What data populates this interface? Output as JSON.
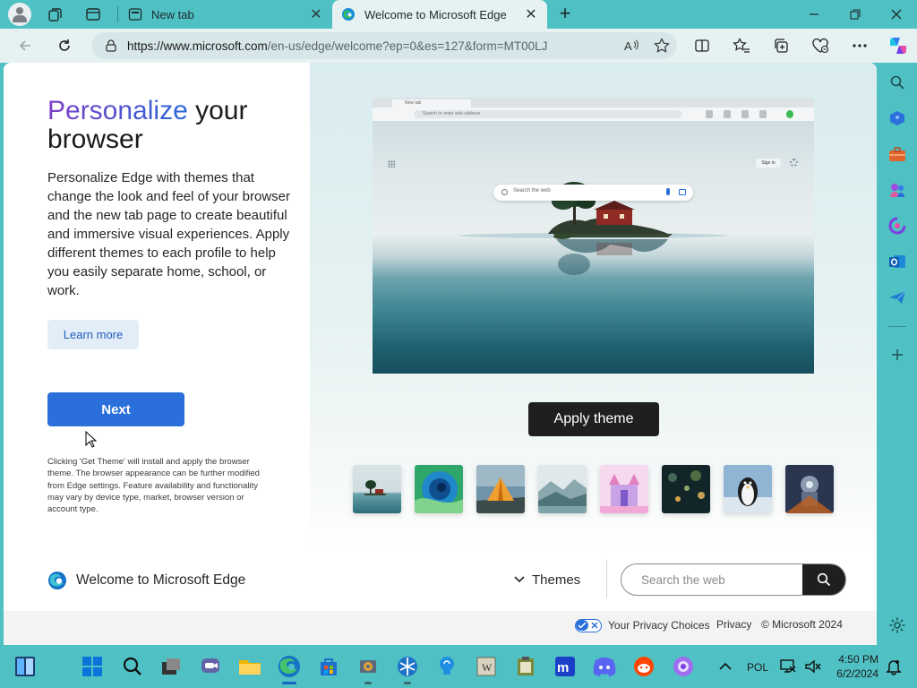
{
  "window": {
    "tabs": [
      {
        "title": "New tab"
      },
      {
        "title": "Welcome to Microsoft Edge"
      }
    ],
    "close_symbol": "✕"
  },
  "addressbar": {
    "url_host": "https://www.microsoft.com",
    "url_path": "/en-us/edge/welcome?ep=0&es=127&form=MT00LJ"
  },
  "left": {
    "headline_accent": "Personalize",
    "headline_rest": " your browser",
    "body": "Personalize Edge with themes that change the look and feel of your browser and the new tab page to create beautiful and immersive visual experiences. Apply different themes to each profile to help you easily separate home, school, or work.",
    "learn_more_label": "Learn more",
    "next_label": "Next",
    "disclaimer": "Clicking 'Get Theme' will install and apply the browser theme. The browser appearance can be further modified from Edge settings. Feature availability and functionality may vary by device type, market, browser version or account type."
  },
  "preview": {
    "tab_title": "New tab",
    "address_placeholder": "Search or enter web address",
    "search_placeholder": "Search the web",
    "signin": "Sign in"
  },
  "right": {
    "apply_label": "Apply theme",
    "thumbnails": [
      "island-lake",
      "green-wave",
      "tent-mountain",
      "misty-mountains",
      "pink-castle",
      "night-bokeh",
      "penguin",
      "space-robot"
    ]
  },
  "footer": {
    "brand": "Welcome to Microsoft Edge",
    "themes_label": "Themes",
    "search_placeholder": "Search the web",
    "privacy_choices": "Your Privacy Choices",
    "privacy": "Privacy",
    "copyright": "© Microsoft 2024"
  },
  "taskbar": {
    "language": "POL",
    "time": "4:50 PM",
    "date": "6/2/2024"
  },
  "colors": {
    "accent": "#4fc1c4",
    "next_button": "#2b6fdb",
    "apply_button": "#1f1f1f"
  }
}
